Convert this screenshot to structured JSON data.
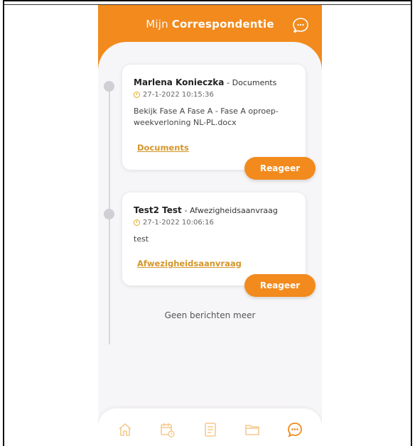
{
  "header": {
    "title_light": "Mijn",
    "title_bold": "Correspondentie",
    "new_message_icon": "chat-plus-icon"
  },
  "messages": [
    {
      "sender": "Marlena Konieczka",
      "type": "- Documents",
      "date": "27-1-2022 10:15:36",
      "body_line1": "Bekijk Fase A Fase A - Fase A oproep-",
      "body_line2": "weekverloning NL-PL.docx",
      "link": "Documents",
      "reply_label": "Reageer"
    },
    {
      "sender": "Test2 Test",
      "type": "- Afwezigheidsaanvraag",
      "date": "27-1-2022 10:06:16",
      "body_line1": "test",
      "body_line2": "",
      "link": "Afwezigheidsaanvraag",
      "reply_label": "Reageer"
    }
  ],
  "end_text": "Geen berichten meer",
  "nav": {
    "items": [
      "home-icon",
      "calendar-icon",
      "document-icon",
      "folder-icon",
      "chat-icon"
    ],
    "active": "chat-icon"
  },
  "colors": {
    "accent": "#f28a1d",
    "link": "#d4962a",
    "nav_inactive": "#f5c98e"
  }
}
